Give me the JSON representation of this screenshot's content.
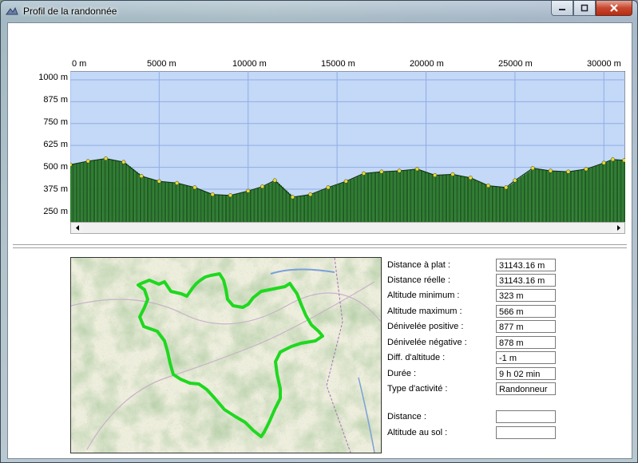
{
  "window": {
    "title": "Profil de la randonnée",
    "controls": [
      "minimize",
      "maximize",
      "close"
    ]
  },
  "profile": {
    "x_ticks": [
      "0 m",
      "5000 m",
      "10000 m",
      "15000 m",
      "20000 m",
      "25000 m",
      "30000 m"
    ],
    "y_ticks": [
      "1000 m",
      "875 m",
      "750 m",
      "625 m",
      "500 m",
      "375 m",
      "250 m"
    ],
    "colors": {
      "sky": "#c4d8f7",
      "grid": "#8faee3",
      "bars": "#2e7d2e",
      "points": "#e6d93a"
    }
  },
  "chart_data": {
    "type": "area",
    "xlabel": "",
    "ylabel": "",
    "xlim": [
      0,
      31200
    ],
    "ylim": [
      188,
      1050
    ],
    "grid": true,
    "x": [
      0,
      1000,
      2000,
      3000,
      4000,
      5000,
      6000,
      7000,
      8000,
      9000,
      10000,
      10800,
      11500,
      12500,
      13500,
      14500,
      15500,
      16500,
      17500,
      18500,
      19500,
      20500,
      21500,
      22500,
      23500,
      24500,
      25000,
      26000,
      27000,
      28000,
      29000,
      30000,
      30500,
      31143
    ],
    "values": [
      515,
      535,
      550,
      530,
      450,
      420,
      410,
      385,
      345,
      340,
      365,
      390,
      425,
      330,
      345,
      385,
      420,
      465,
      475,
      480,
      490,
      455,
      460,
      440,
      395,
      385,
      425,
      495,
      480,
      475,
      490,
      525,
      545,
      540
    ]
  },
  "map": {
    "route_color": "#22dd22"
  },
  "stats": [
    {
      "label": "Distance à plat :",
      "value": "31143.16 m"
    },
    {
      "label": "Distance réelle :",
      "value": "31143.16 m"
    },
    {
      "label": "Altitude minimum :",
      "value": "323 m"
    },
    {
      "label": "Altitude maximum :",
      "value": "566 m"
    },
    {
      "label": "Dénivelée positive :",
      "value": "877 m"
    },
    {
      "label": "Dénivelée négative :",
      "value": "878 m"
    },
    {
      "label": "Diff. d'altitude :",
      "value": "-1 m"
    },
    {
      "label": "Durée :",
      "value": "9 h 02 min"
    },
    {
      "label": "Type d'activité :",
      "value": "Randonneur"
    }
  ],
  "cursor": [
    {
      "label": "Distance :",
      "value": ""
    },
    {
      "label": "Altitude au sol :",
      "value": ""
    }
  ]
}
